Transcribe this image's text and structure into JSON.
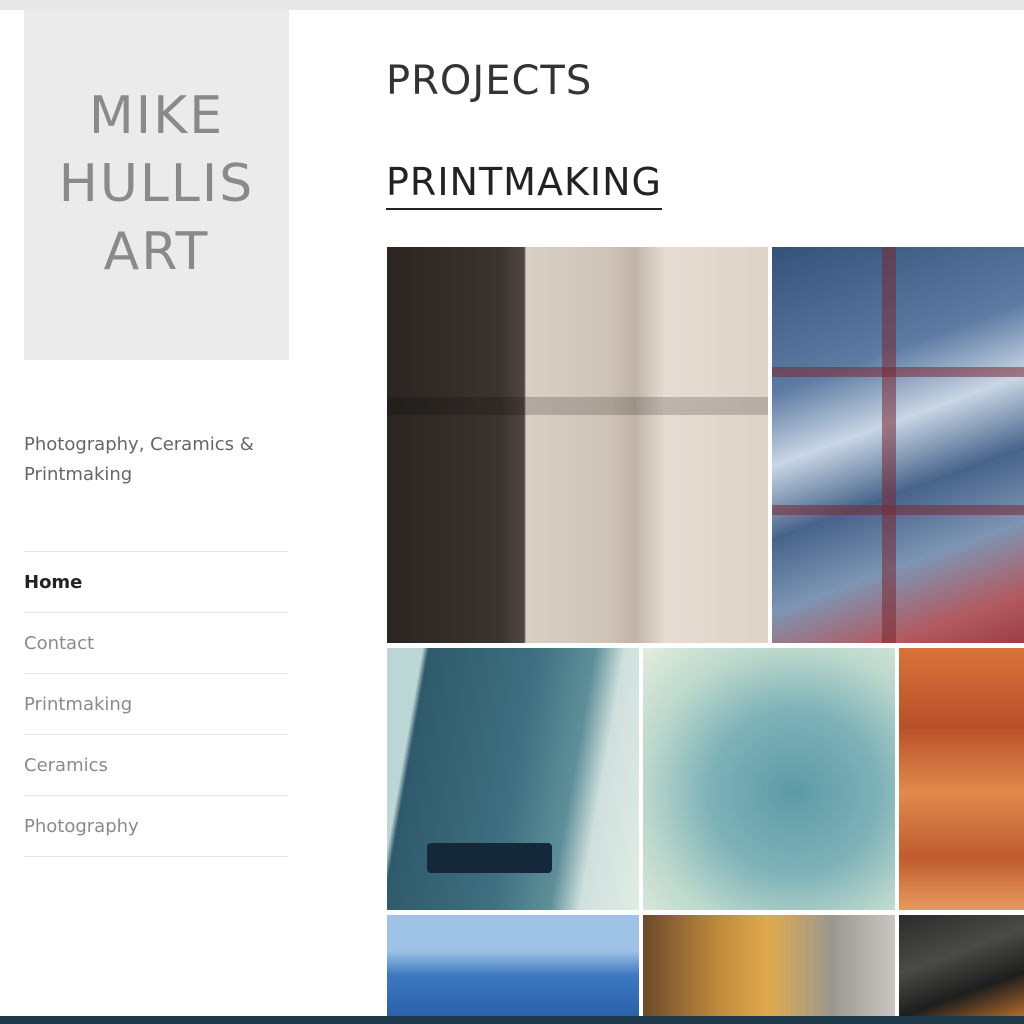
{
  "site": {
    "logo_lines": [
      "MIKE",
      "HULLIS",
      "ART"
    ],
    "tagline": "Photography, Ceramics & Printmaking"
  },
  "nav": {
    "items": [
      {
        "label": "Home",
        "active": true
      },
      {
        "label": "Contact",
        "active": false
      },
      {
        "label": "Printmaking",
        "active": false
      },
      {
        "label": "Ceramics",
        "active": false
      },
      {
        "label": "Photography",
        "active": false
      }
    ]
  },
  "main": {
    "page_title": "PROJECTS",
    "section_title": "PRINTMAKING"
  },
  "colors": {
    "logo_bg": "#ebebeb",
    "text_dark": "#222222",
    "text_muted": "#8a8a8a"
  }
}
